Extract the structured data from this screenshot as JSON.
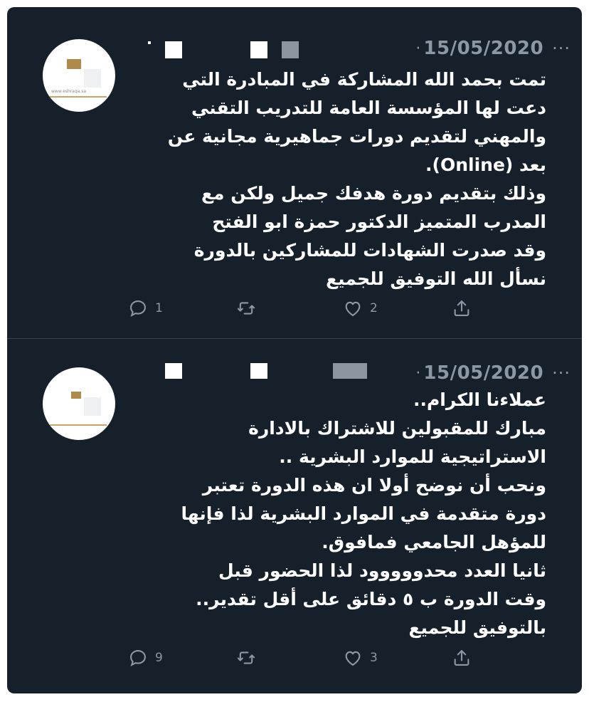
{
  "tweets": [
    {
      "avatar_url_text": "www.eshraqa.sa",
      "date_dot": "·",
      "date": "15/05/2020",
      "more": "···",
      "lines": [
        "تمت بحمد الله المشاركة في المبادرة التي",
        "دعت لها المؤسسة العامة للتدريب التقني",
        "والمهني لتقديم دورات جماهيرية مجانية عن",
        "بعد (Online).",
        "وذلك بتقديم دورة هدفك جميل ولكن مع",
        "المدرب المتميز الدكتور حمزة ابو الفتح",
        "وقد صدرت الشهادات للمشاركين بالدورة",
        "نسأل الله التوفيق للجميع"
      ],
      "reply_count": "1",
      "retweet_count": "",
      "like_count": "2"
    },
    {
      "avatar_url_text": "",
      "date_dot": "·",
      "date": "15/05/2020",
      "more": "···",
      "lines": [
        "عملاءنا الكرام..",
        "مبارك للمقبولين للاشتراك بالادارة",
        "الاستراتيجية للموارد البشرية ..",
        "ونحب أن نوضح أولا ان هذه الدورة تعتبر",
        "دورة متقدمة في الموارد البشرية لذا فإنها",
        "للمؤهل الجامعي فمافوق.",
        "ثانيا العدد محدووووود لذا الحضور قبل",
        "وقت الدورة ب ٥ دقائق على أقل تقدير..",
        "بالتوفيق للجميع"
      ],
      "reply_count": "9",
      "retweet_count": "",
      "like_count": "3"
    }
  ],
  "colors": {
    "background": "#15202b",
    "text": "#ffffff",
    "secondary": "#8b98a5",
    "divider": "#38444d"
  },
  "icons": [
    "reply-icon",
    "retweet-icon",
    "like-icon",
    "share-icon",
    "more-icon"
  ]
}
